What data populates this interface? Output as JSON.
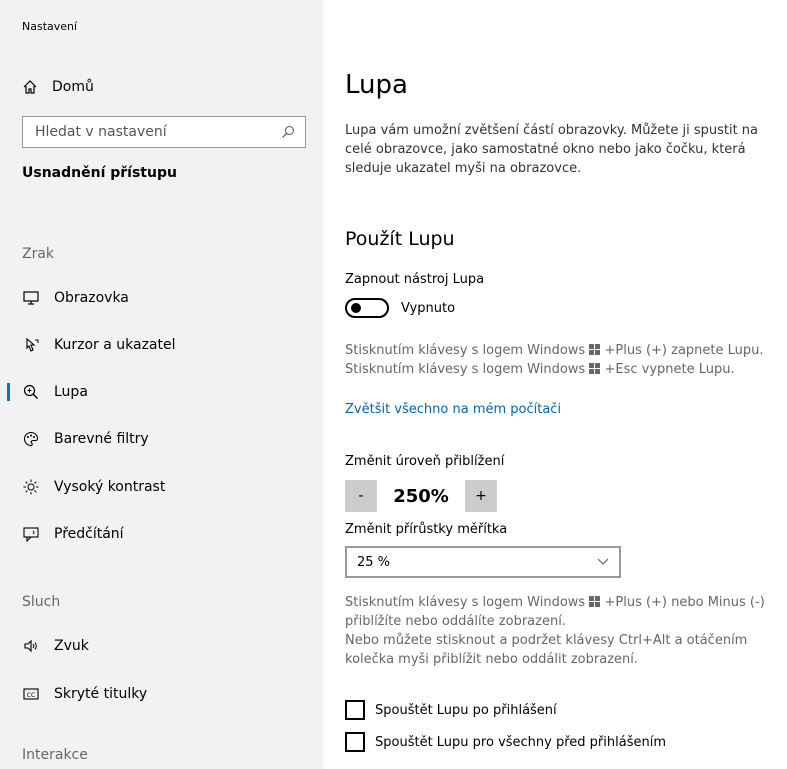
{
  "app": {
    "title": "Nastavení"
  },
  "sidebar": {
    "home_label": "Domů",
    "search_placeholder": "Hledat v nastavení",
    "section_heading": "Usnadnění přístupu",
    "groups": {
      "vision": "Zrak",
      "hearing": "Sluch",
      "interaction": "Interakce"
    },
    "items": [
      {
        "label": "Obrazovka",
        "icon": "monitor-icon"
      },
      {
        "label": "Kurzor a ukazatel",
        "icon": "cursor-icon"
      },
      {
        "label": "Lupa",
        "icon": "magnifier-icon",
        "active": true
      },
      {
        "label": "Barevné filtry",
        "icon": "palette-icon"
      },
      {
        "label": "Vysoký kontrast",
        "icon": "brightness-icon"
      },
      {
        "label": "Předčítání",
        "icon": "narrator-icon"
      },
      {
        "label": "Zvuk",
        "icon": "speaker-icon"
      },
      {
        "label": "Skryté titulky",
        "icon": "captions-icon"
      }
    ],
    "accent_color": "#0078d7"
  },
  "main": {
    "title": "Lupa",
    "description": "Lupa vám umožní zvětšení částí obrazovky. Můžete ji spustit na celé obrazovce, jako samostatné okno nebo jako čočku, která sleduje ukazatel myši na obrazovce.",
    "use_heading": "Použít Lupu",
    "toggle_label": "Zapnout nástroj Lupa",
    "toggle_state": "Vypnuto",
    "toggle_on": false,
    "shortcut_hint": {
      "line1_pre": "Stisknutím klávesy s logem Windows",
      "line1_post": "+Plus (+) zapnete Lupu.",
      "line2_pre": "Stisknutím klávesy s logem Windows",
      "line2_post": "+Esc vypnete Lupu."
    },
    "link": "Zvětšit všechno na mém počítači",
    "zoom_label": "Změnit úroveň přiblížení",
    "zoom_minus": "-",
    "zoom_value": "250%",
    "zoom_plus": "+",
    "increment_label": "Změnit přírůstky měřítka",
    "increment_value": "25 %",
    "zoom_hint": {
      "line1_pre": "Stisknutím klávesy s logem Windows",
      "line1_post": "+Plus (+) nebo Minus (-)",
      "line2": "přiblížíte nebo oddálíte zobrazení.",
      "line3": "Nebo můžete stisknout a podržet klávesy Ctrl+Alt a otáčením",
      "line4": "kolečka myši přiblížit nebo oddálit zobrazení."
    },
    "checkbox1": "Spouštět Lupu po přihlášení",
    "checkbox2": "Spouštět Lupu pro všechny před přihlášením",
    "link_color": "#0066b4"
  }
}
